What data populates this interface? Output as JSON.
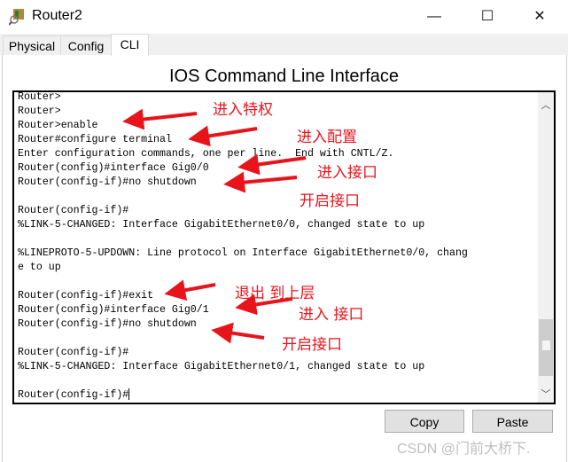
{
  "window": {
    "title": "Router2",
    "minimize": "—",
    "maximize": "☐",
    "close": "✕",
    "icon": "router-icon"
  },
  "tabs": [
    {
      "label": "Physical"
    },
    {
      "label": "Config"
    },
    {
      "label": "CLI",
      "active": true
    }
  ],
  "heading": "IOS Command Line Interface",
  "terminal": {
    "lines": [
      "Router>",
      "Router>",
      "Router>enable",
      "Router#configure terminal",
      "Enter configuration commands, one per line.  End with CNTL/Z.",
      "Router(config)#interface Gig0/0",
      "Router(config-if)#no shutdown",
      "",
      "Router(config-if)#",
      "%LINK-5-CHANGED: Interface GigabitEthernet0/0, changed state to up",
      "",
      "%LINEPROTO-5-UPDOWN: Line protocol on Interface GigabitEthernet0/0, chang",
      "e to up",
      "",
      "Router(config-if)#exit",
      "Router(config)#interface Gig0/1",
      "Router(config-if)#no shutdown",
      "",
      "Router(config-if)#",
      "%LINK-5-CHANGED: Interface GigabitEthernet0/1, changed state to up",
      "",
      "Router(config-if)#"
    ],
    "scroll_position_percent": 95
  },
  "buttons": {
    "copy": "Copy",
    "paste": "Paste"
  },
  "annotations": [
    "进入特权",
    "进入配置",
    "进入接口",
    "开启接口",
    "退出 到上层",
    "进入 接口",
    "开启接口"
  ],
  "annotation_color": "#e8141c",
  "watermark": "CSDN @门前大桥下."
}
